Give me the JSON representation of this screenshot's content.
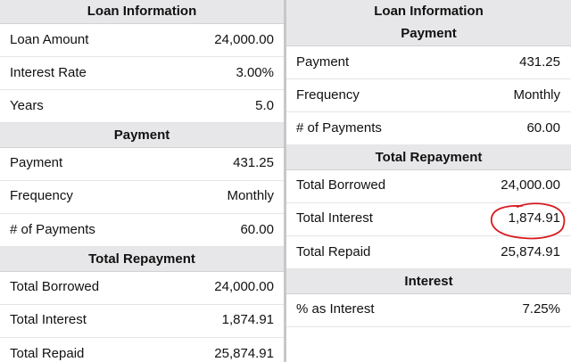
{
  "left": {
    "sections": [
      {
        "title": "Loan Information",
        "rows": [
          {
            "label": "Loan Amount",
            "value": "24,000.00"
          },
          {
            "label": "Interest Rate",
            "value": "3.00%"
          },
          {
            "label": "Years",
            "value": "5.0"
          }
        ]
      },
      {
        "title": "Payment",
        "rows": [
          {
            "label": "Payment",
            "value": "431.25"
          },
          {
            "label": "Frequency",
            "value": "Monthly"
          },
          {
            "label": "# of Payments",
            "value": "60.00"
          }
        ]
      },
      {
        "title": "Total Repayment",
        "rows": [
          {
            "label": "Total Borrowed",
            "value": "24,000.00"
          },
          {
            "label": "Total Interest",
            "value": "1,874.91"
          },
          {
            "label": "Total Repaid",
            "value": "25,874.91"
          }
        ]
      }
    ]
  },
  "right": {
    "top_title": "Loan Information",
    "sections": [
      {
        "title": "Payment",
        "rows": [
          {
            "label": "Payment",
            "value": "431.25"
          },
          {
            "label": "Frequency",
            "value": "Monthly"
          },
          {
            "label": "# of Payments",
            "value": "60.00"
          }
        ]
      },
      {
        "title": "Total Repayment",
        "rows": [
          {
            "label": "Total Borrowed",
            "value": "24,000.00"
          },
          {
            "label": "Total Interest",
            "value": "1,874.91"
          },
          {
            "label": "Total Repaid",
            "value": "25,874.91"
          }
        ]
      },
      {
        "title": "Interest",
        "rows": [
          {
            "label": "% as Interest",
            "value": "7.25%"
          }
        ]
      }
    ]
  },
  "colors": {
    "section_header_bg": "#e7e7e9",
    "divider": "#c7c7c7",
    "annotation": "#d8191f"
  }
}
